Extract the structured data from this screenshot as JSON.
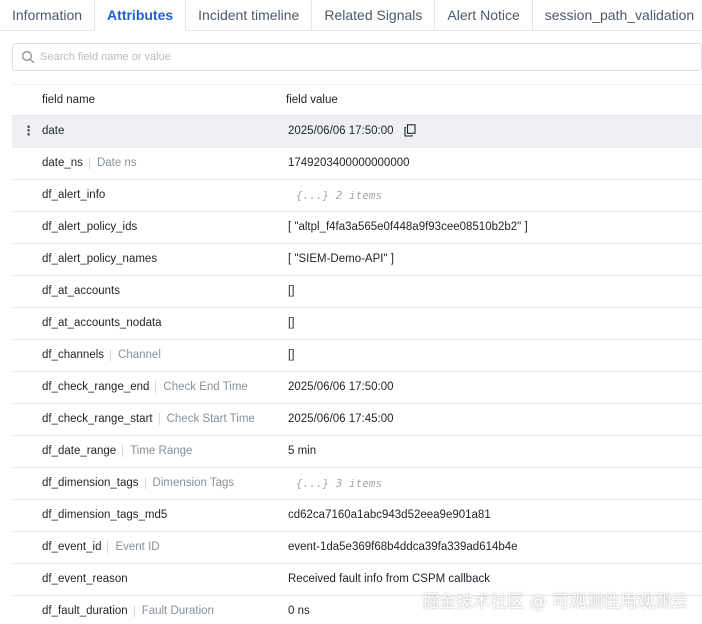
{
  "tabs": [
    {
      "label": "Information",
      "active": false
    },
    {
      "label": "Attributes",
      "active": true
    },
    {
      "label": "Incident timeline",
      "active": false
    },
    {
      "label": "Related Signals",
      "active": false
    },
    {
      "label": "Alert Notice",
      "active": false
    },
    {
      "label": "session_path_validation",
      "active": false
    }
  ],
  "search": {
    "placeholder": "Search field name or value",
    "value": ""
  },
  "table": {
    "headers": {
      "name": "field name",
      "value": "field value"
    },
    "rows": [
      {
        "name": "date",
        "alias": "",
        "value": "2025/06/06 17:50:00",
        "mono": false
      },
      {
        "name": "date_ns",
        "alias": "Date ns",
        "value": "1749203400000000000",
        "mono": false
      },
      {
        "name": "df_alert_info",
        "alias": "",
        "value": "{...} 2 items",
        "mono": true
      },
      {
        "name": "df_alert_policy_ids",
        "alias": "",
        "value": "[ \"altpl_f4fa3a565e0f448a9f93cee08510b2b2\" ]",
        "mono": false
      },
      {
        "name": "df_alert_policy_names",
        "alias": "",
        "value": "[ \"SIEM-Demo-API\" ]",
        "mono": false
      },
      {
        "name": "df_at_accounts",
        "alias": "",
        "value": "[]",
        "mono": false
      },
      {
        "name": "df_at_accounts_nodata",
        "alias": "",
        "value": "[]",
        "mono": false
      },
      {
        "name": "df_channels",
        "alias": "Channel",
        "value": "[]",
        "mono": false
      },
      {
        "name": "df_check_range_end",
        "alias": "Check End Time",
        "value": "2025/06/06 17:50:00",
        "mono": false
      },
      {
        "name": "df_check_range_start",
        "alias": "Check Start Time",
        "value": "2025/06/06 17:45:00",
        "mono": false
      },
      {
        "name": "df_date_range",
        "alias": "Time Range",
        "value": "5 min",
        "mono": false
      },
      {
        "name": "df_dimension_tags",
        "alias": "Dimension Tags",
        "value": "{...} 3 items",
        "mono": true
      },
      {
        "name": "df_dimension_tags_md5",
        "alias": "",
        "value": "cd62ca7160a1abc943d52eea9e901a81",
        "mono": false
      },
      {
        "name": "df_event_id",
        "alias": "Event ID",
        "value": "event-1da5e369f68b4ddca39fa339ad614b4e",
        "mono": false
      },
      {
        "name": "df_event_reason",
        "alias": "",
        "value": "Received fault info from CSPM callback",
        "mono": false
      },
      {
        "name": "df_fault_duration",
        "alias": "Fault Duration",
        "value": "0 ns",
        "mono": false
      }
    ]
  },
  "watermark": "掘金技术社区 @ 可观测性用观测云",
  "colors": {
    "accent": "#1d5fd6",
    "row_highlight": "#eef0f3"
  }
}
